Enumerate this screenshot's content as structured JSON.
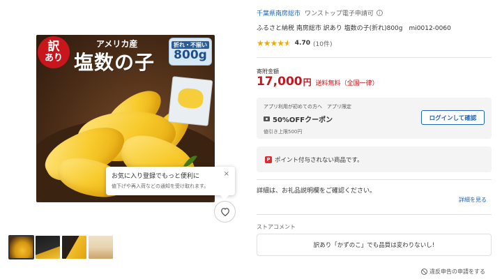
{
  "product_image": {
    "badge_line1": "訳",
    "badge_line2": "あり",
    "origin": "アメリカ産",
    "name": "塩数の子",
    "weight_label": "折れ・不揃い",
    "weight": "800g"
  },
  "favorite_popup": {
    "title": "お気に入り登録でもっと便利に",
    "description": "値下げや再入荷などの通知を受け取れます。",
    "close_label": "×"
  },
  "thumbnails": [
    {
      "label": "",
      "active": true
    },
    {
      "label": "",
      "active": false
    },
    {
      "label": "",
      "active": false
    },
    {
      "label": "",
      "active": false
    }
  ],
  "vendor": {
    "name": "千葉県南房総市",
    "tag": "ワンストップ電子申請可"
  },
  "product": {
    "title": "ふるさと納税 南房総市 訳あり 塩数の子(折れ)800g　mi0012-0060",
    "rating": "4.70",
    "review_count": "(10件)"
  },
  "price": {
    "label": "寄附金額",
    "amount": "17,000",
    "unit": "円",
    "shipping": "送料無料（全国一律）"
  },
  "coupon": {
    "note": "アプリ利用が初めての方へ　アプリ限定",
    "title": "50%OFFクーポン",
    "limit": "値引き上限500円",
    "login_label": "ログインして確認"
  },
  "points": {
    "icon_text": "P",
    "message": "ポイント付与されない商品です。"
  },
  "details": {
    "text": "詳細は、お礼品説明欄をご確認ください。",
    "link": "詳細を見る"
  },
  "store_comment": {
    "label": "ストアコメント",
    "text": "訳あり「かずのこ」でも品質は変わりないし!"
  },
  "report": {
    "label": "違反申告の申請をする"
  },
  "colors": {
    "price_red": "#c8161d",
    "link_blue": "#1d65b8",
    "star_gold": "#f2a900"
  }
}
